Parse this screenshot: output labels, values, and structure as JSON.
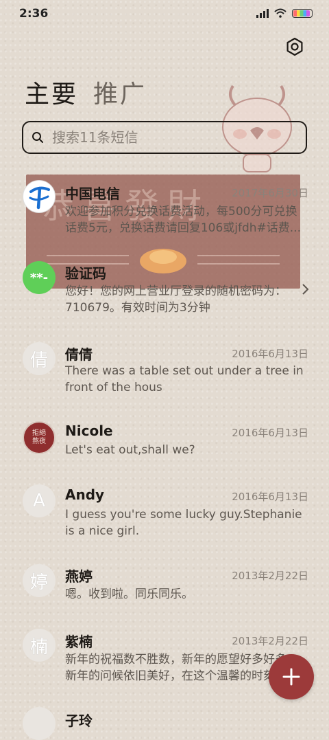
{
  "status": {
    "time": "2:36"
  },
  "tabs": [
    {
      "label": "主要"
    },
    {
      "label": "推广"
    }
  ],
  "search": {
    "placeholder": "搜索11条短信"
  },
  "banner": {
    "text": "恭喜發財"
  },
  "conversations": [
    {
      "name": "中国电信",
      "date": "2017年6月30日",
      "preview": "欢迎参加积分兑换话费活动，每500分可兑换话费5元，兑换话费请回复106或jfdh#话费...",
      "avatar": "china-telecom-logo"
    },
    {
      "name": "验证码",
      "date": "",
      "preview": "您好！您的网上营业厅登录的随机密码为：710679。有效时间为3分钟",
      "avatar_text": "**-"
    },
    {
      "name": "倩倩",
      "date": "2016年6月13日",
      "preview": "There was a table set out under a tree in front of the hous",
      "avatar_text": "倩"
    },
    {
      "name": "Nicole",
      "date": "2016年6月13日",
      "preview": "Let's eat out,shall we?",
      "avatar_text": "拒絕熬夜"
    },
    {
      "name": "Andy",
      "date": "2016年6月13日",
      "preview": "I guess you're some lucky guy.Stephanie is a nice girl.",
      "avatar_text": "A"
    },
    {
      "name": "燕婷",
      "date": "2013年2月22日",
      "preview": "嗯。收到啦。同乐同乐。",
      "avatar_text": "婷"
    },
    {
      "name": "紫楠",
      "date": "2013年2月22日",
      "preview": "新年的祝福数不胜数，新年的愿望好多好多，新年的问候依旧美好，在这个温馨的时刻",
      "avatar_text": "楠"
    },
    {
      "name": "子玲",
      "date": "",
      "preview": "",
      "avatar_text": ""
    }
  ],
  "colors": {
    "fab": "#9c3a3a",
    "verify_avatar": "#5fcf58",
    "telecom_blue": "#1a6fd1"
  }
}
